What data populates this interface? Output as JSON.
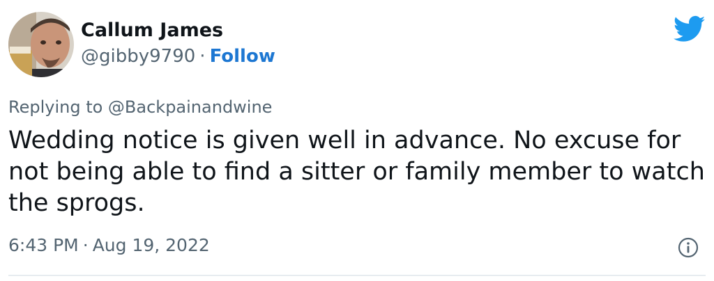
{
  "author": {
    "name": "Callum James",
    "handle": "@gibby9790",
    "separator": "·",
    "follow_label": "Follow",
    "avatar_icon": "profile-photo"
  },
  "brand": {
    "icon": "twitter-bird-icon",
    "color": "#1d9bf0"
  },
  "tweet": {
    "replying_to": "Replying to @Backpainandwine",
    "text": "Wedding notice is given well in advance. No excuse for not being able to find a sitter or family member to watch the sprogs.",
    "time": "6:43 PM",
    "separator": "·",
    "date": "Aug 19, 2022"
  },
  "colors": {
    "text_primary": "#0f1419",
    "text_secondary": "#536471",
    "follow": "#1d77d2",
    "divider": "#e7ecf0"
  }
}
